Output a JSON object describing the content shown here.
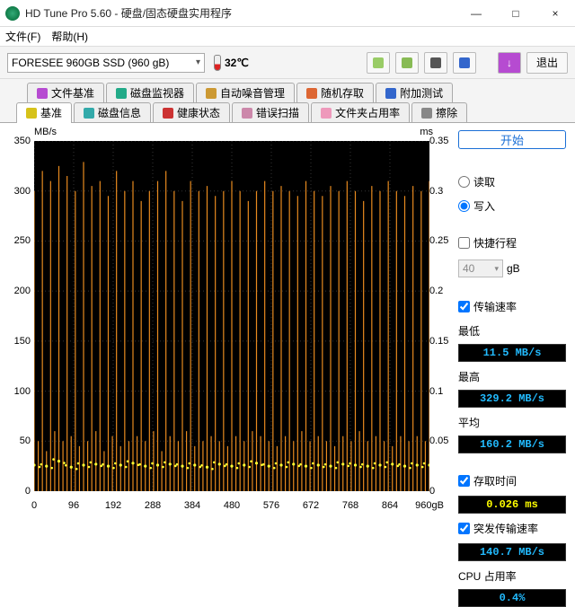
{
  "window": {
    "title": "HD Tune Pro 5.60 - 硬盘/固态硬盘实用程序",
    "minimize": "—",
    "maximize": "□",
    "close": "×"
  },
  "menu": {
    "file": "文件(F)",
    "help": "帮助(H)"
  },
  "toolbar": {
    "drive": "FORESEE 960GB SSD (960 gB)",
    "temp": "32℃",
    "exit": "退出"
  },
  "tabs_top": [
    {
      "icon": "#b64bd1",
      "label": "文件基准"
    },
    {
      "icon": "#2a8",
      "label": "磁盘监视器"
    },
    {
      "icon": "#c93",
      "label": "自动噪音管理"
    },
    {
      "icon": "#d63",
      "label": "随机存取"
    },
    {
      "icon": "#36c",
      "label": "附加测试"
    }
  ],
  "tabs_bottom": [
    {
      "icon": "#d6c21a",
      "label": "基准",
      "active": true
    },
    {
      "icon": "#3aa",
      "label": "磁盘信息"
    },
    {
      "icon": "#c33",
      "label": "健康状态"
    },
    {
      "icon": "#c8a",
      "label": "错误扫描"
    },
    {
      "icon": "#e9b",
      "label": "文件夹占用率"
    },
    {
      "icon": "#888",
      "label": "擦除"
    }
  ],
  "chart_data": {
    "type": "line",
    "title": "",
    "x_label": "",
    "y_left_label": "MB/s",
    "y_right_label": "ms",
    "x_range": [
      0,
      960
    ],
    "x_unit": "gB",
    "y_left_range": [
      0,
      350
    ],
    "y_right_range": [
      0,
      0.35
    ],
    "x_ticks": [
      0,
      96,
      192,
      288,
      384,
      480,
      576,
      672,
      768,
      864
    ],
    "y_left_ticks": [
      0,
      50,
      100,
      150,
      200,
      250,
      300,
      350
    ],
    "y_right_ticks": [
      0,
      0.05,
      0.1,
      0.15,
      0.2,
      0.25,
      0.3,
      0.35
    ],
    "series": [
      {
        "name": "传输速率(写入)",
        "color": "#e78a1f",
        "stat": {
          "min_mb_s": 11.5,
          "max_mb_s": 329.2,
          "avg_mb_s": 160.2
        },
        "x": [
          0,
          10,
          20,
          30,
          40,
          50,
          60,
          70,
          80,
          90,
          100,
          110,
          120,
          130,
          140,
          150,
          160,
          170,
          180,
          190,
          200,
          210,
          220,
          230,
          240,
          250,
          260,
          270,
          280,
          290,
          300,
          310,
          320,
          330,
          340,
          350,
          360,
          370,
          380,
          390,
          400,
          410,
          420,
          430,
          440,
          450,
          460,
          470,
          480,
          490,
          500,
          510,
          520,
          530,
          540,
          550,
          560,
          570,
          580,
          590,
          600,
          610,
          620,
          630,
          640,
          650,
          660,
          670,
          680,
          690,
          700,
          710,
          720,
          730,
          740,
          750,
          760,
          770,
          780,
          790,
          800,
          810,
          820,
          830,
          840,
          850,
          860,
          870,
          880,
          890,
          900,
          910,
          920,
          930,
          940,
          950,
          960
        ],
        "y": [
          300,
          50,
          320,
          40,
          310,
          60,
          325,
          50,
          315,
          55,
          300,
          45,
          329,
          50,
          305,
          60,
          310,
          40,
          295,
          55,
          320,
          45,
          300,
          50,
          310,
          55,
          290,
          50,
          300,
          60,
          310,
          40,
          320,
          55,
          300,
          50,
          290,
          60,
          310,
          45,
          300,
          50,
          305,
          55,
          295,
          50,
          300,
          45,
          310,
          55,
          300,
          50,
          290,
          60,
          300,
          55,
          310,
          50,
          300,
          45,
          305,
          55,
          300,
          50,
          295,
          60,
          310,
          50,
          300,
          55,
          295,
          50,
          305,
          45,
          300,
          55,
          310,
          50,
          300,
          60,
          290,
          50,
          305,
          55,
          300,
          50,
          310,
          45,
          300,
          55,
          295,
          50,
          305,
          55,
          300,
          50,
          310
        ]
      },
      {
        "name": "存取时间",
        "color": "#ffff33",
        "stat": {
          "avg_ms": 0.026
        },
        "x": [
          0,
          30,
          60,
          90,
          120,
          150,
          180,
          210,
          240,
          270,
          300,
          330,
          360,
          390,
          420,
          450,
          480,
          510,
          540,
          570,
          600,
          630,
          660,
          690,
          720,
          750,
          780,
          810,
          840,
          870,
          900,
          930,
          960
        ],
        "y_ms": [
          0.026,
          0.025,
          0.03,
          0.024,
          0.026,
          0.027,
          0.025,
          0.026,
          0.028,
          0.025,
          0.026,
          0.027,
          0.025,
          0.026,
          0.024,
          0.027,
          0.025,
          0.026,
          0.028,
          0.025,
          0.026,
          0.027,
          0.025,
          0.026,
          0.025,
          0.027,
          0.026,
          0.025,
          0.026,
          0.027,
          0.025,
          0.026,
          0.026
        ]
      }
    ]
  },
  "panel": {
    "start": "开始",
    "read": "读取",
    "write": "写入",
    "mode_selected": "write",
    "shortstroke": "快捷行程",
    "blocksize": "40",
    "blockunit": "gB",
    "transfer_rate": "传输速率",
    "min_lbl": "最低",
    "min_val": "11.5 MB/s",
    "max_lbl": "最高",
    "max_val": "329.2 MB/s",
    "avg_lbl": "平均",
    "avg_val": "160.2 MB/s",
    "access_time": "存取时间",
    "access_val": "0.026 ms",
    "burst": "突发传输速率",
    "burst_val": "140.7 MB/s",
    "cpu": "CPU 占用率",
    "cpu_val": "0.4%"
  },
  "x_end_label": "960gB"
}
